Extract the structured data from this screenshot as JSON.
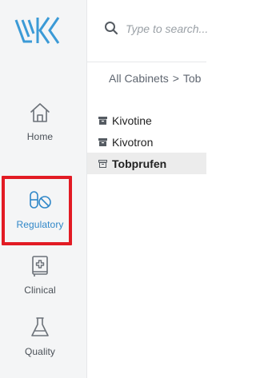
{
  "sidebar": {
    "logo": "kivo-logo",
    "items": [
      {
        "label": "Home",
        "icon": "home-icon"
      },
      {
        "label": "Regulatory",
        "icon": "flask-ban-icon",
        "active": true
      },
      {
        "label": "Clinical",
        "icon": "medical-book-icon"
      },
      {
        "label": "Quality",
        "icon": "beaker-icon"
      }
    ]
  },
  "search": {
    "placeholder": "Type to search..."
  },
  "breadcrumb": {
    "root": "All Cabinets",
    "separator": ">",
    "current": "Tob"
  },
  "tree": {
    "items": [
      {
        "label": "Kivotine",
        "icon": "cabinet-icon"
      },
      {
        "label": "Kivotron",
        "icon": "cabinet-icon"
      },
      {
        "label": "Tobprufen",
        "icon": "cabinet-open-icon",
        "selected": true
      }
    ]
  },
  "colors": {
    "accent": "#2f87c8",
    "highlight": "#e21b24",
    "sidebar_bg": "#f4f5f6"
  }
}
